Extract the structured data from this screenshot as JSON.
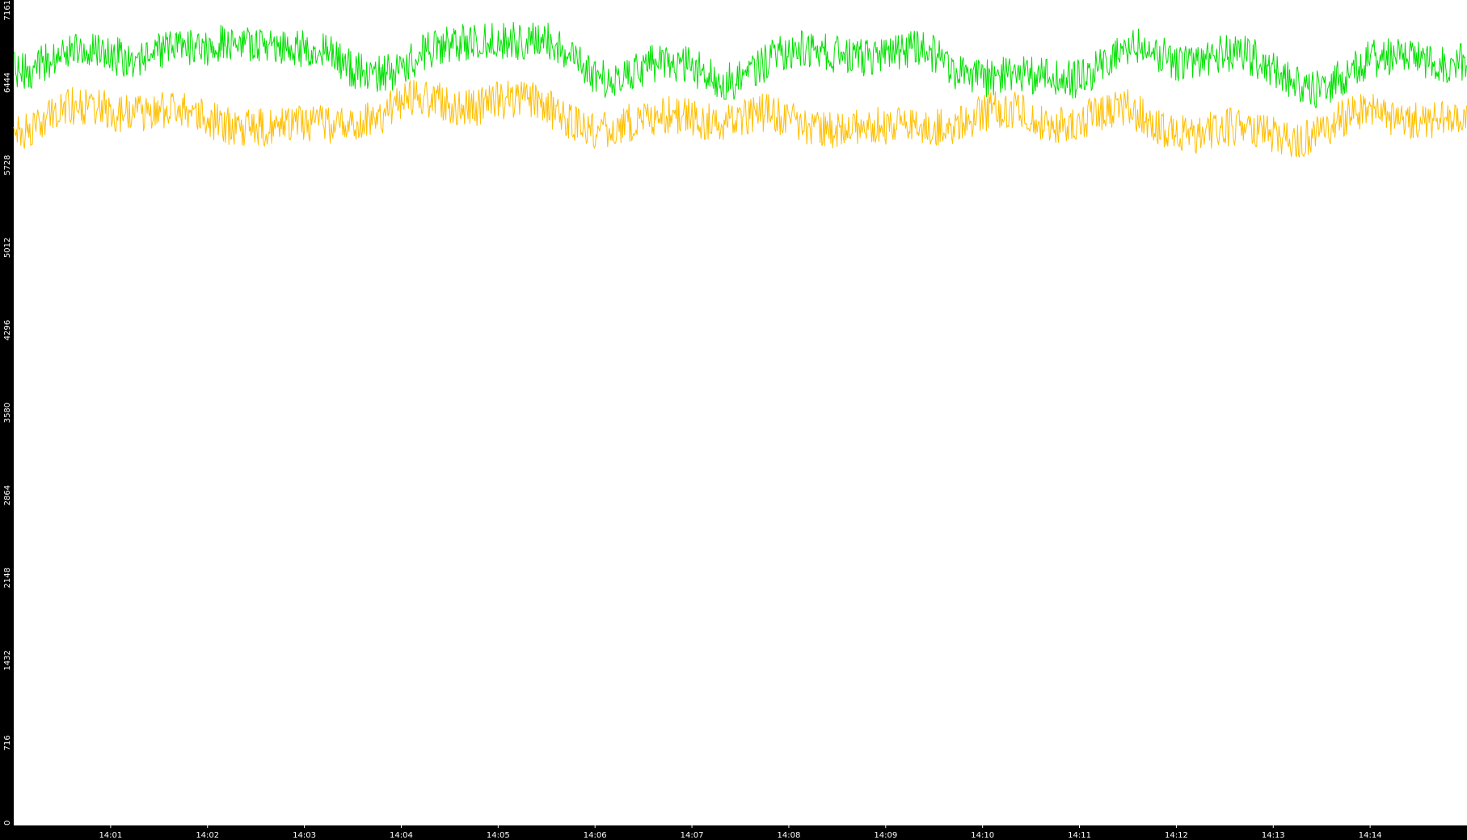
{
  "chart_data": {
    "type": "line",
    "title": "",
    "xlabel": "",
    "ylabel": "",
    "ylim": [
      0,
      7161
    ],
    "y_ticks": [
      "0",
      "716",
      "1432",
      "2148",
      "2864",
      "3580",
      "4296",
      "5012",
      "5728",
      "6444",
      "7161"
    ],
    "x_range": [
      "14:00:00",
      "14:15:00"
    ],
    "x_ticks": [
      "14:01",
      "14:02",
      "14:03",
      "14:04",
      "14:05",
      "14:06",
      "14:07",
      "14:08",
      "14:09",
      "14:10",
      "14:11",
      "14:12",
      "14:13",
      "14:14"
    ],
    "grid": false,
    "legend": "none",
    "background_color": "#ffffff",
    "axis_band_color": "#000000",
    "tick_label_color": "#ffffff",
    "series": [
      {
        "color": "#00e000",
        "x": [
          "14:00",
          "14:00:30",
          "14:01",
          "14:01:30",
          "14:02",
          "14:02:30",
          "14:03",
          "14:03:30",
          "14:04",
          "14:04:30",
          "14:05",
          "14:05:30",
          "14:06",
          "14:06:30",
          "14:07",
          "14:07:30",
          "14:08",
          "14:08:30",
          "14:09",
          "14:09:30",
          "14:10",
          "14:10:30",
          "14:11",
          "14:11:30",
          "14:12",
          "14:12:30",
          "14:13",
          "14:13:30",
          "14:14",
          "14:14:30",
          "14:15"
        ],
        "values": [
          6600,
          6750,
          6700,
          6750,
          6650,
          6800,
          6700,
          6600,
          6650,
          6750,
          6850,
          6700,
          6500,
          6600,
          6600,
          6550,
          6650,
          6700,
          6600,
          6700,
          6550,
          6500,
          6550,
          6650,
          6600,
          6700,
          6550,
          6500,
          6600,
          6700,
          6550
        ]
      },
      {
        "color": "#ffbf00",
        "x": [
          "14:00",
          "14:00:30",
          "14:01",
          "14:01:30",
          "14:02",
          "14:02:30",
          "14:03",
          "14:03:30",
          "14:04",
          "14:04:30",
          "14:05",
          "14:05:30",
          "14:06",
          "14:06:30",
          "14:07",
          "14:07:30",
          "14:08",
          "14:08:30",
          "14:09",
          "14:09:30",
          "14:10",
          "14:10:30",
          "14:11",
          "14:11:30",
          "14:12",
          "14:12:30",
          "14:13",
          "14:13:30",
          "14:14",
          "14:14:30",
          "14:15"
        ],
        "values": [
          6100,
          6150,
          6200,
          6150,
          6100,
          6150,
          6050,
          6150,
          6200,
          6200,
          6300,
          6200,
          6150,
          6100,
          6150,
          6100,
          6050,
          6100,
          6050,
          6150,
          6150,
          6100,
          6100,
          6150,
          6100,
          6050,
          6050,
          6000,
          6100,
          6150,
          6100
        ]
      }
    ]
  }
}
